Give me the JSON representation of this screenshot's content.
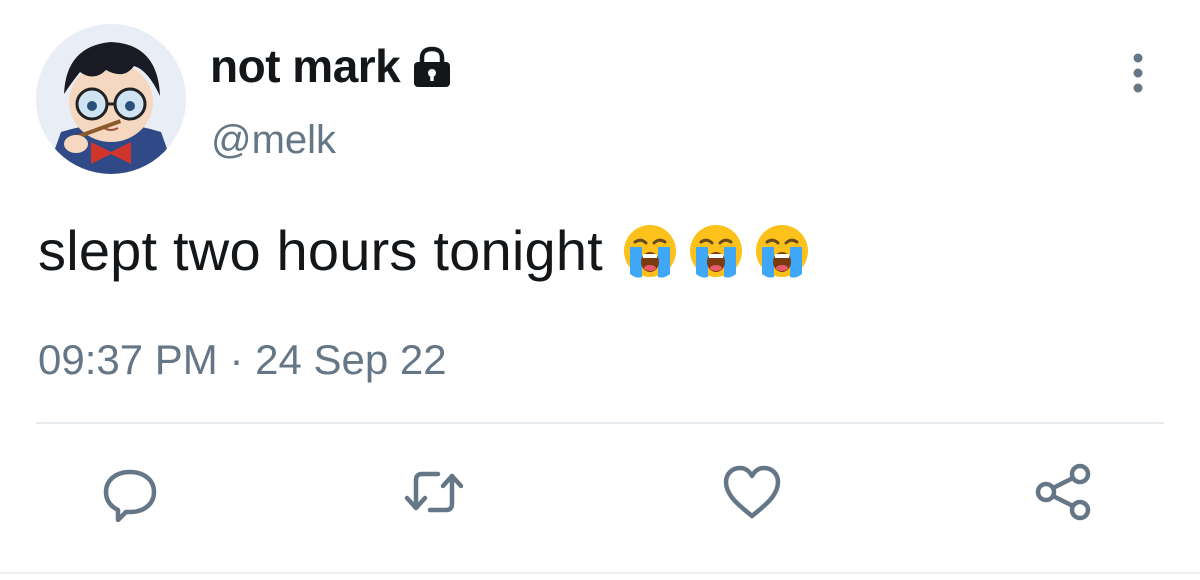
{
  "tweet": {
    "display_name": "not mark",
    "handle": "@melk",
    "text": "slept two hours tonight",
    "emojis": [
      "loudly-crying-face",
      "loudly-crying-face",
      "loudly-crying-face"
    ],
    "timestamp": "09:37 PM · 24 Sep 22",
    "protected": true
  },
  "icons": {
    "lock": "lock-icon",
    "more": "more-vertical-icon",
    "reply": "reply-icon",
    "retweet": "retweet-icon",
    "like": "heart-icon",
    "share": "share-icon"
  },
  "colors": {
    "text_primary": "#14171a",
    "text_secondary": "#657786",
    "icon_gray": "#657786",
    "divider": "#e6ecf0"
  }
}
